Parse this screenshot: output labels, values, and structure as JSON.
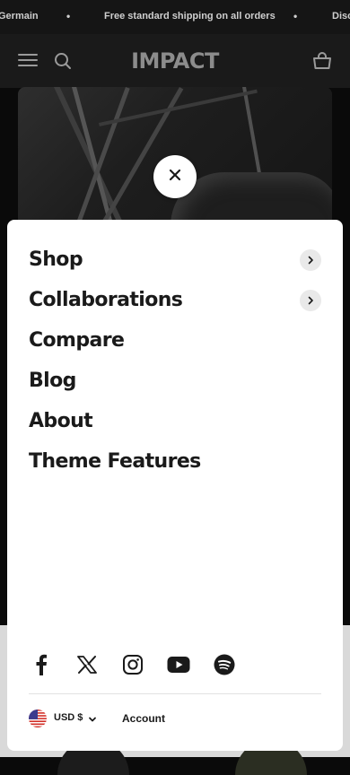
{
  "announcement": {
    "items": [
      "Germain",
      "Free standard shipping on all orders",
      "Disc"
    ]
  },
  "header": {
    "logo": "IMPACT",
    "menu_icon": "hamburger-icon",
    "search_icon": "search-icon",
    "cart_icon": "cart-icon"
  },
  "drawer": {
    "close_icon": "close-icon",
    "menu": [
      {
        "label": "Shop",
        "has_submenu": true
      },
      {
        "label": "Collaborations",
        "has_submenu": true
      },
      {
        "label": "Compare",
        "has_submenu": false
      },
      {
        "label": "Blog",
        "has_submenu": false
      },
      {
        "label": "About",
        "has_submenu": false
      },
      {
        "label": "Theme Features",
        "has_submenu": false
      }
    ],
    "socials": [
      "facebook-icon",
      "x-icon",
      "instagram-icon",
      "youtube-icon",
      "spotify-icon"
    ],
    "currency": "USD $",
    "account_label": "Account"
  },
  "colors": {
    "announcement_bg": "#151515",
    "header_bg": "#1a1a1a",
    "drawer_bg": "#ffffff",
    "text": "#1a1a1a"
  }
}
